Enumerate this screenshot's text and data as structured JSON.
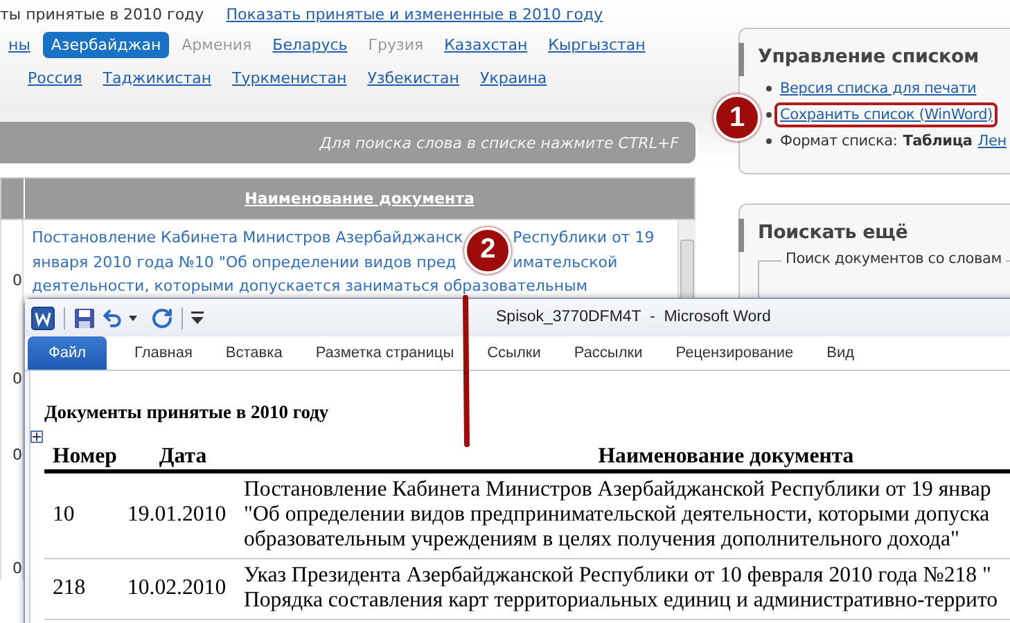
{
  "page": {
    "heading_tail": "ты принятые в 2010 году",
    "changes_link": "Показать принятые и измененные в 2010 году",
    "country_rows": [
      {
        "items": [
          {
            "label": "ны",
            "selected": false,
            "disabled": false
          },
          {
            "label": "Азербайджан",
            "selected": true,
            "disabled": false
          },
          {
            "label": "Армения",
            "selected": false,
            "disabled": true
          },
          {
            "label": "Беларусь",
            "selected": false,
            "disabled": false
          },
          {
            "label": "Грузия",
            "selected": false,
            "disabled": true
          },
          {
            "label": "Казахстан",
            "selected": false,
            "disabled": false
          },
          {
            "label": "Кыргызстан",
            "selected": false,
            "disabled": false
          }
        ]
      },
      {
        "items": [
          {
            "label": "Россия",
            "selected": false,
            "disabled": false
          },
          {
            "label": "Таджикистан",
            "selected": false,
            "disabled": false
          },
          {
            "label": "Туркменистан",
            "selected": false,
            "disabled": false
          },
          {
            "label": "Узбекистан",
            "selected": false,
            "disabled": false
          },
          {
            "label": "Украина",
            "selected": false,
            "disabled": false
          }
        ]
      }
    ],
    "search_hint": "Для поиска слова в списке нажмите CTRL+F",
    "table": {
      "column": "Наименование документа",
      "rows": [
        {
          "number": "0",
          "lines": [
            {
              "parts": [
                "Постановление Кабинета Министров Азербайджанск",
                "Республики от 19"
              ]
            },
            {
              "parts": [
                "января 2010 года №10 \"Об определении видов пред",
                "имательской"
              ]
            },
            {
              "parts": [
                "деятельности, которыми допускается заниматься образовательным"
              ]
            }
          ]
        },
        {
          "number": "0"
        },
        {
          "number": "0"
        },
        {
          "number": "0"
        }
      ]
    }
  },
  "sidebar": {
    "manage": {
      "title": "Управление списком",
      "items": [
        {
          "kind": "link",
          "text": "Версия списка для печати",
          "highlighted": false
        },
        {
          "kind": "link",
          "text": "Сохранить список (WinWord)",
          "highlighted": true
        },
        {
          "kind": "format",
          "label": "Формат списка:",
          "value": "Таблица",
          "link": "Лен"
        }
      ]
    },
    "search": {
      "title": "Поискать ещё",
      "legend": "Поиск документов со словам"
    }
  },
  "markers": [
    {
      "number": "1"
    },
    {
      "number": "2"
    }
  ],
  "word_window": {
    "title": "Spisok_3770DFM4T  -  Microsoft Word",
    "tabs": [
      {
        "label": "Файл",
        "selected": true
      },
      {
        "label": "Главная",
        "selected": false
      },
      {
        "label": "Вставка",
        "selected": false
      },
      {
        "label": "Разметка страницы",
        "selected": false
      },
      {
        "label": "Ссылки",
        "selected": false
      },
      {
        "label": "Рассылки",
        "selected": false
      },
      {
        "label": "Рецензирование",
        "selected": false
      },
      {
        "label": "Вид",
        "selected": false
      }
    ],
    "document": {
      "heading": "Документы принятые в 2010 году",
      "columns": [
        "Номер",
        "Дата",
        "Наименование документа"
      ],
      "rows": [
        {
          "number": "10",
          "date": "19.01.2010",
          "lines": [
            "Постановление Кабинета Министров Азербайджанской Республики от 19 январ",
            "\"Об определении видов предпринимательской деятельности, которыми допуска",
            "образовательным учреждениям в целях получения дополнительного дохода\""
          ]
        },
        {
          "number": "218",
          "date": "10.02.2010",
          "lines": [
            "Указ Президента Азербайджанской Республики от 10 февраля 2010 года №218 \"",
            "Порядка составления карт территориальных единиц и административно-террито"
          ]
        }
      ]
    }
  }
}
